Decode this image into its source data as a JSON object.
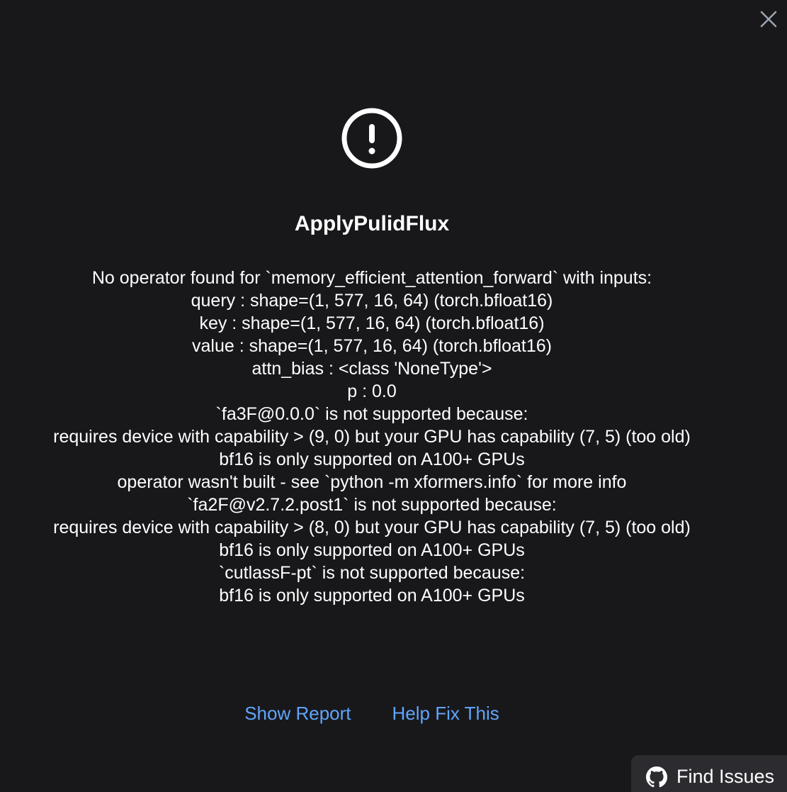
{
  "dialog": {
    "close_icon": "close-icon",
    "alert_icon": "exclamation-circle-icon",
    "title": "ApplyPulidFlux",
    "message_lines": [
      "No operator found for `memory_efficient_attention_forward` with inputs:",
      "query : shape=(1, 577, 16, 64) (torch.bfloat16)",
      "key : shape=(1, 577, 16, 64) (torch.bfloat16)",
      "value : shape=(1, 577, 16, 64) (torch.bfloat16)",
      "attn_bias : <class 'NoneType'>",
      "p : 0.0",
      "`fa3F@0.0.0` is not supported because:",
      "requires device with capability > (9, 0) but your GPU has capability (7, 5) (too old)",
      "bf16 is only supported on A100+ GPUs",
      "operator wasn't built - see `python -m xformers.info` for more info",
      "`fa2F@v2.7.2.post1` is not supported because:",
      "requires device with capability > (8, 0) but your GPU has capability (7, 5) (too old)",
      "bf16 is only supported on A100+ GPUs",
      "`cutlassF-pt` is not supported because:",
      "bf16 is only supported on A100+ GPUs"
    ],
    "actions": {
      "show_report": "Show Report",
      "help_fix": "Help Fix This"
    },
    "find_issues": {
      "icon": "github-icon",
      "label": "Find Issues"
    }
  },
  "colors": {
    "background": "#18181b",
    "text": "#ffffff",
    "link": "#60a5fa",
    "find_issues_bg": "#2b2b30",
    "close_icon": "#9ca3af"
  }
}
